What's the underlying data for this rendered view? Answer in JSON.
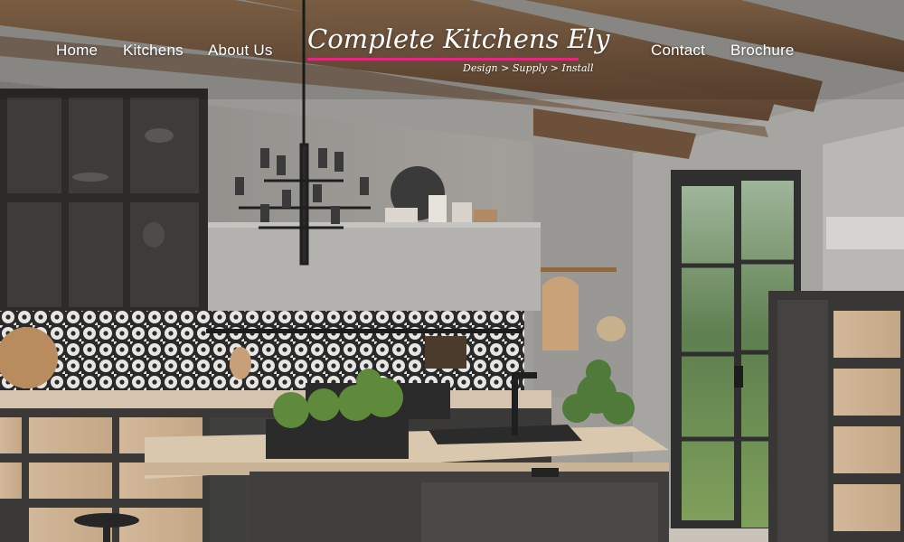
{
  "nav": {
    "left": [
      "Home",
      "Kitchens",
      "About Us"
    ],
    "right": [
      "Contact",
      "Brochure"
    ]
  },
  "logo": {
    "name": "Complete Kitchens Ely",
    "tagline": "Design > Supply > Install",
    "accent_color": "#e0287f"
  },
  "hero": {
    "scene": "kitchen-photo"
  }
}
